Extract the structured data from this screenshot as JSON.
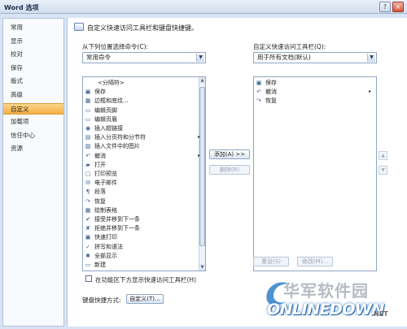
{
  "window": {
    "title": "Word 选项",
    "help": "?",
    "close": "×"
  },
  "sidebar": {
    "items": [
      {
        "label": "常用",
        "active": false
      },
      {
        "label": "显示",
        "active": false
      },
      {
        "label": "校对",
        "active": false
      },
      {
        "label": "保存",
        "active": false
      },
      {
        "label": "版式",
        "active": false
      },
      {
        "label": "高级",
        "active": false
      },
      {
        "label": "自定义",
        "active": true
      },
      {
        "label": "加载项",
        "active": false
      },
      {
        "label": "信任中心",
        "active": false
      },
      {
        "label": "资源",
        "active": false
      }
    ]
  },
  "main": {
    "header": "自定义快速访问工具栏和键盘快捷键。",
    "left_label": "从下列位置选择命令(C):",
    "left_select": "常用命令",
    "right_label": "自定义快速访问工具栏(Q):",
    "right_select": "用于所有文档(默认)",
    "commands": [
      {
        "icon": "",
        "label": "<分隔符>",
        "submenu": false
      },
      {
        "icon": "▣",
        "label": "保存",
        "submenu": false
      },
      {
        "icon": "▦",
        "label": "边框和底纹...",
        "submenu": false
      },
      {
        "icon": "▭",
        "label": "编辑页脚",
        "submenu": false
      },
      {
        "icon": "▭",
        "label": "编辑页眉",
        "submenu": false
      },
      {
        "icon": "◉",
        "label": "插入超链接",
        "submenu": false
      },
      {
        "icon": "▤",
        "label": "插入分页符和分节符",
        "submenu": true
      },
      {
        "icon": "▨",
        "label": "插入文件中的图片",
        "submenu": false
      },
      {
        "icon": "↶",
        "label": "撤消",
        "submenu": true
      },
      {
        "icon": "▰",
        "label": "打开",
        "submenu": false
      },
      {
        "icon": "▢",
        "label": "打印预览",
        "submenu": false
      },
      {
        "icon": "✉",
        "label": "电子邮件",
        "submenu": false
      },
      {
        "icon": "¶",
        "label": "段落",
        "submenu": false
      },
      {
        "icon": "↷",
        "label": "恢复",
        "submenu": false
      },
      {
        "icon": "▦",
        "label": "绘制表格",
        "submenu": false
      },
      {
        "icon": "✔",
        "label": "接受并移到下一条",
        "submenu": false
      },
      {
        "icon": "✘",
        "label": "拒绝并移到下一条",
        "submenu": false
      },
      {
        "icon": "▣",
        "label": "快速打印",
        "submenu": false
      },
      {
        "icon": "✓",
        "label": "拼写和语法",
        "submenu": false
      },
      {
        "icon": "✱",
        "label": "全部显示",
        "submenu": false
      },
      {
        "icon": "▭",
        "label": "新建",
        "submenu": false
      }
    ],
    "toolbar_items": [
      {
        "icon": "▣",
        "label": "保存",
        "submenu": false
      },
      {
        "icon": "↶",
        "label": "撤消",
        "submenu": true
      },
      {
        "icon": "↷",
        "label": "恢复",
        "submenu": false
      }
    ],
    "add_button": "添加(A) >>",
    "remove_button": "删除(R)",
    "reset_button": "重设(S)",
    "modify_button": "修改(M)...",
    "up": "▲",
    "down": "▼",
    "checkbox_label": "在功能区下方显示快速访问工具栏(H)",
    "shortcut_label": "键盘快捷方式:",
    "customize_button": "自定义(T)..."
  },
  "watermark": {
    "cn": "华军软件园",
    "en": "ONLINEDOWN",
    "suffix": ".NET"
  }
}
